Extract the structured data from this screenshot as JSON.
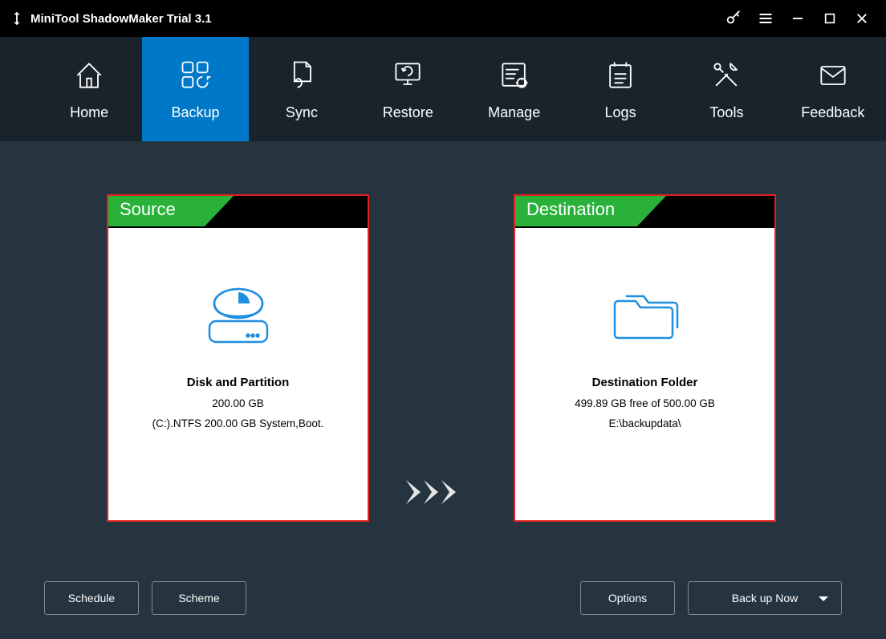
{
  "app": {
    "title": "MiniTool ShadowMaker Trial 3.1"
  },
  "nav": {
    "items": [
      {
        "label": "Home"
      },
      {
        "label": "Backup"
      },
      {
        "label": "Sync"
      },
      {
        "label": "Restore"
      },
      {
        "label": "Manage"
      },
      {
        "label": "Logs"
      },
      {
        "label": "Tools"
      },
      {
        "label": "Feedback"
      }
    ],
    "active_index": 1
  },
  "source": {
    "tab": "Source",
    "title": "Disk and Partition",
    "size": "200.00 GB",
    "detail": "(C:).NTFS 200.00 GB System,Boot."
  },
  "destination": {
    "tab": "Destination",
    "title": "Destination Folder",
    "free": "499.89 GB free of 500.00 GB",
    "path": "E:\\backupdata\\"
  },
  "footer": {
    "schedule": "Schedule",
    "scheme": "Scheme",
    "options": "Options",
    "back_up_now": "Back up Now"
  }
}
